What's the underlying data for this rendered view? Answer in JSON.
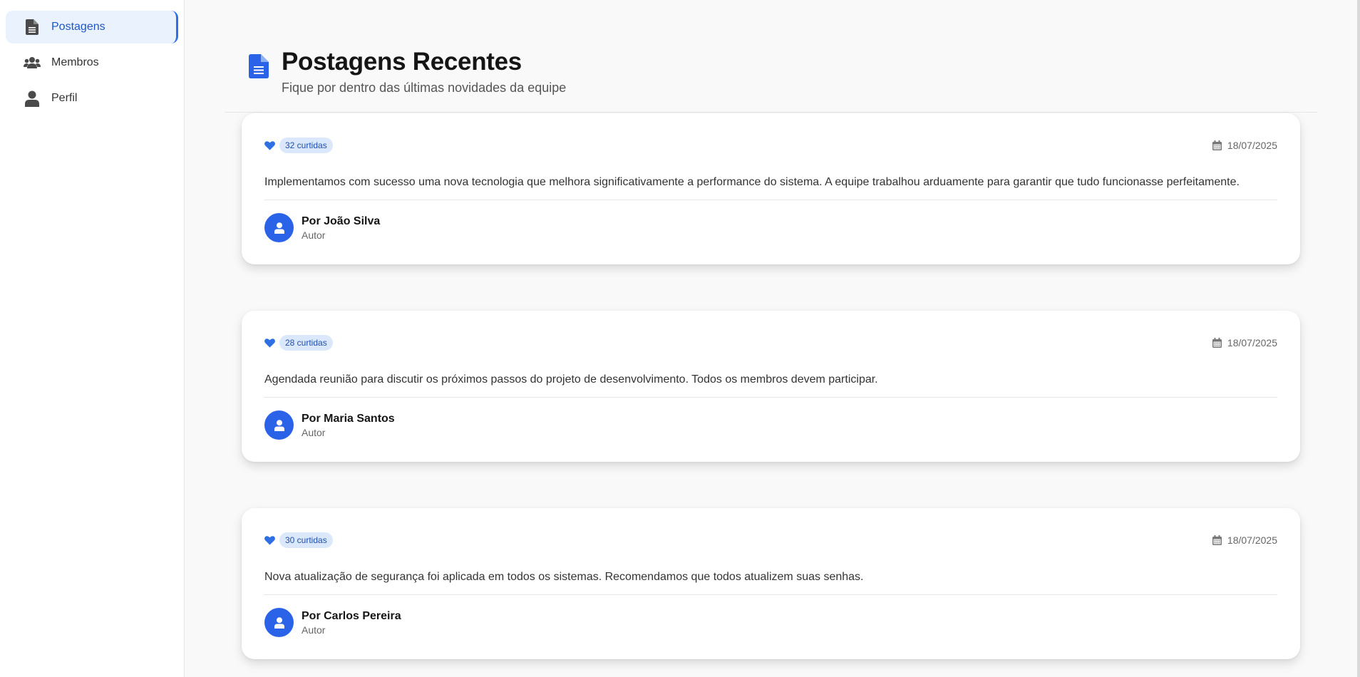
{
  "sidebar": {
    "items": [
      {
        "label": "Postagens",
        "icon": "document-icon",
        "active": true
      },
      {
        "label": "Membros",
        "icon": "users-icon",
        "active": false
      },
      {
        "label": "Perfil",
        "icon": "user-icon",
        "active": false
      }
    ]
  },
  "header": {
    "title": "Postagens Recentes",
    "subtitle": "Fique por dentro das últimas novidades da equipe"
  },
  "posts": [
    {
      "likes": "32 curtidas",
      "date": "18/07/2025",
      "body": "Implementamos com sucesso uma nova tecnologia que melhora significativamente a performance do sistema. A equipe trabalhou arduamente para garantir que tudo funcionasse perfeitamente.",
      "author": "Por João Silva",
      "role": "Autor"
    },
    {
      "likes": "28 curtidas",
      "date": "18/07/2025",
      "body": "Agendada reunião para discutir os próximos passos do projeto de desenvolvimento. Todos os membros devem participar.",
      "author": "Por Maria Santos",
      "role": "Autor"
    },
    {
      "likes": "30 curtidas",
      "date": "18/07/2025",
      "body": "Nova atualização de segurança foi aplicada em todos os sistemas. Recomendamos que todos atualizem suas senhas.",
      "author": "Por Carlos Pereira",
      "role": "Autor"
    }
  ],
  "colors": {
    "accent": "#2b63e8",
    "active_bg": "#eaf2fd",
    "badge_bg": "#dbe8fc",
    "page_bg": "#f9f9f9"
  }
}
